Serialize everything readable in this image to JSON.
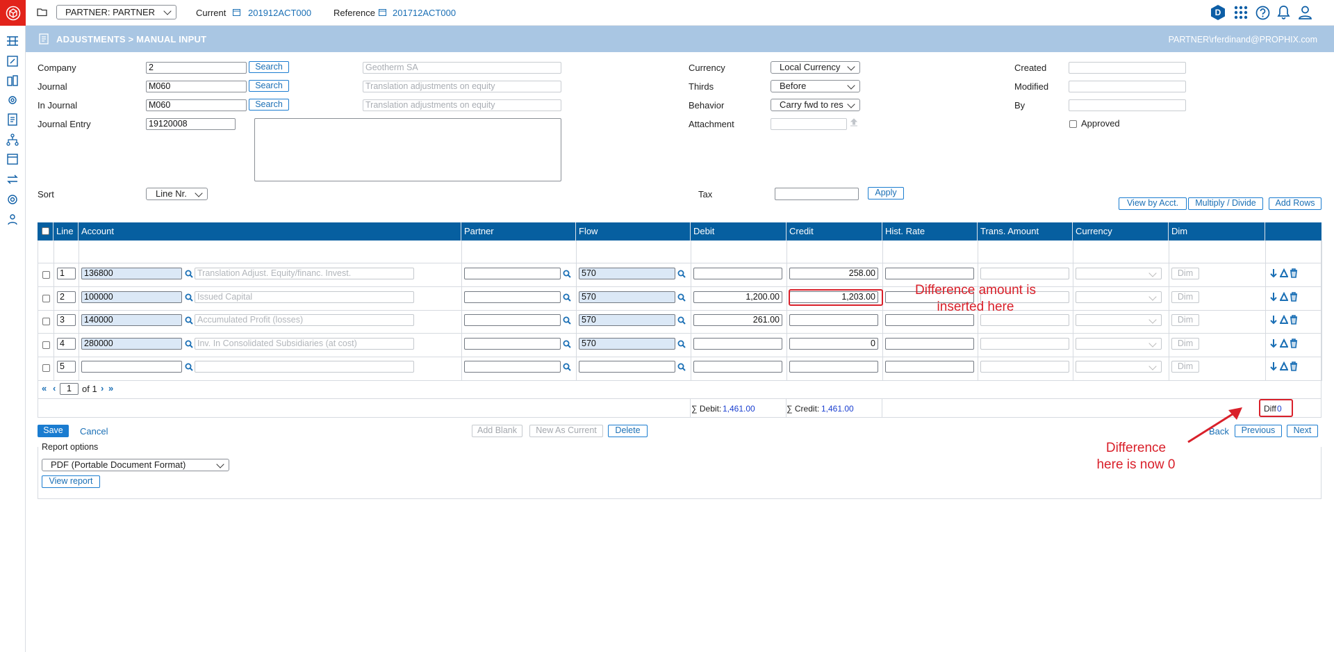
{
  "topbar": {
    "partner_select": "PARTNER: PARTNER",
    "current_label": "Current",
    "current_value": "201912ACT000",
    "reference_label": "Reference",
    "reference_value": "201712ACT000",
    "avatar_letter": "D"
  },
  "header": {
    "title": "ADJUSTMENTS > MANUAL INPUT",
    "user": "PARTNER\\rferdinand@PROPHIX.com"
  },
  "form": {
    "company_label": "Company",
    "company_value": "2",
    "company_search": "Search",
    "company_name_placeholder": "Geotherm SA",
    "journal_label": "Journal",
    "journal_value": "M060",
    "journal_search": "Search",
    "journal_name_placeholder": "Translation adjustments on equity",
    "injournal_label": "In Journal",
    "injournal_value": "M060",
    "injournal_search": "Search",
    "injournal_name_placeholder": "Translation adjustments on equity",
    "entry_label": "Journal Entry",
    "entry_value": "19120008",
    "currency_label": "Currency",
    "currency_value": "Local Currency",
    "thirds_label": "Thirds",
    "thirds_value": "Before",
    "behavior_label": "Behavior",
    "behavior_value": "Carry fwd to res",
    "attachment_label": "Attachment",
    "created_label": "Created",
    "modified_label": "Modified",
    "by_label": "By",
    "approved_label": "Approved",
    "sort_label": "Sort",
    "sort_value": "Line Nr.",
    "tax_label": "Tax",
    "apply_label": "Apply"
  },
  "toolbar": {
    "view_by_acct": "View by Acct.",
    "multiply_divide": "Multiply / Divide",
    "add_rows": "Add Rows"
  },
  "grid": {
    "columns": [
      "Line",
      "Account",
      "Partner",
      "Flow",
      "Debit",
      "Credit",
      "Hist. Rate",
      "Trans. Amount",
      "Currency",
      "Dim"
    ],
    "dim_label": "Dim",
    "rows": [
      {
        "line": "1",
        "account": "136800",
        "account_desc": "Translation Adjust. Equity/financ. Invest.",
        "flow": "570",
        "debit": "",
        "credit": "258.00"
      },
      {
        "line": "2",
        "account": "100000",
        "account_desc": "Issued Capital",
        "flow": "570",
        "debit": "1,200.00",
        "credit": "1,203.00"
      },
      {
        "line": "3",
        "account": "140000",
        "account_desc": "Accumulated Profit (losses)",
        "flow": "570",
        "debit": "261.00",
        "credit": ""
      },
      {
        "line": "4",
        "account": "280000",
        "account_desc": "Inv. In Consolidated Subsidiaries (at cost)",
        "flow": "570",
        "debit": "",
        "credit": "0"
      },
      {
        "line": "5",
        "account": "",
        "account_desc": "",
        "flow": "",
        "debit": "",
        "credit": ""
      }
    ],
    "pager": {
      "page": "1",
      "of_text": "of 1"
    },
    "totals": {
      "debit_label": "∑ Debit:",
      "debit_value": "1,461.00",
      "credit_label": "∑ Credit:",
      "credit_value": "1,461.00",
      "diff_label": "Diff",
      "diff_value": "0"
    }
  },
  "actions": {
    "save": "Save",
    "cancel": "Cancel",
    "add_blank": "Add Blank",
    "new_as_current": "New As Current",
    "delete": "Delete",
    "back": "Back",
    "previous": "Previous",
    "next": "Next"
  },
  "report": {
    "legend": "Report options",
    "format_value": "PDF (Portable Document Format)",
    "view_report": "View report"
  },
  "annotations": {
    "callout_1_line1": "Difference amount is",
    "callout_1_line2": "inserted here",
    "callout_2_line1": "Difference",
    "callout_2_line2": "here is now 0"
  },
  "colors": {
    "brand_red": "#e2231a",
    "header_blue": "#065fa0",
    "band_blue": "#a9c6e3",
    "accent": "#1a7cd0",
    "annotation_red": "#d9202a"
  }
}
